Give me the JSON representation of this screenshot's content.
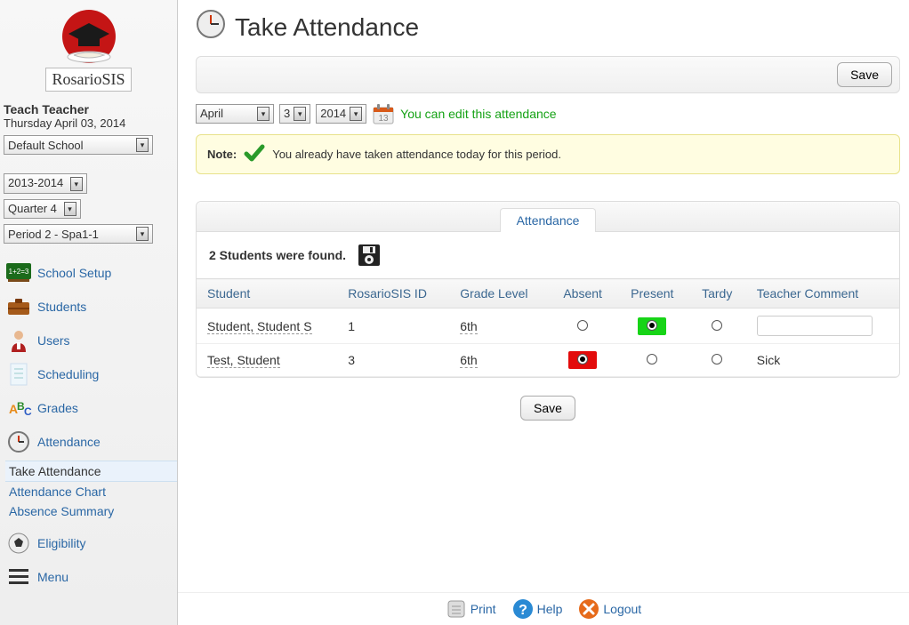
{
  "logo_name": "RosarioSIS",
  "user": {
    "name": "Teach Teacher",
    "date": "Thursday April 03, 2014"
  },
  "selectors": {
    "school": "Default School",
    "year": "2013-2014",
    "quarter": "Quarter 4",
    "period": "Period 2 - Spa1-1"
  },
  "nav": {
    "school_setup": "School Setup",
    "students": "Students",
    "users": "Users",
    "scheduling": "Scheduling",
    "grades": "Grades",
    "attendance": "Attendance",
    "take_attendance": "Take Attendance",
    "attendance_chart": "Attendance Chart",
    "absence_summary": "Absence Summary",
    "eligibility": "Eligibility",
    "menu": "Menu"
  },
  "page_title": "Take Attendance",
  "toolbar": {
    "save": "Save"
  },
  "date": {
    "month": "April",
    "day": "3",
    "year": "2014",
    "edit_text": "You can edit this attendance"
  },
  "note": {
    "label": "Note:",
    "text": "You already have taken attendance today for this period."
  },
  "panel": {
    "tab": "Attendance",
    "found_text": "2 Students were found.",
    "headers": {
      "student": "Student",
      "id": "RosarioSIS ID",
      "grade": "Grade Level",
      "absent": "Absent",
      "present": "Present",
      "tardy": "Tardy",
      "comment": "Teacher Comment"
    },
    "rows": [
      {
        "student": "Student, Student S",
        "id": "1",
        "grade": "6th",
        "status": "present",
        "comment": ""
      },
      {
        "student": "Test, Student",
        "id": "3",
        "grade": "6th",
        "status": "absent",
        "comment": "Sick"
      }
    ]
  },
  "save_button": "Save",
  "footer": {
    "print": "Print",
    "help": "Help",
    "logout": "Logout"
  }
}
